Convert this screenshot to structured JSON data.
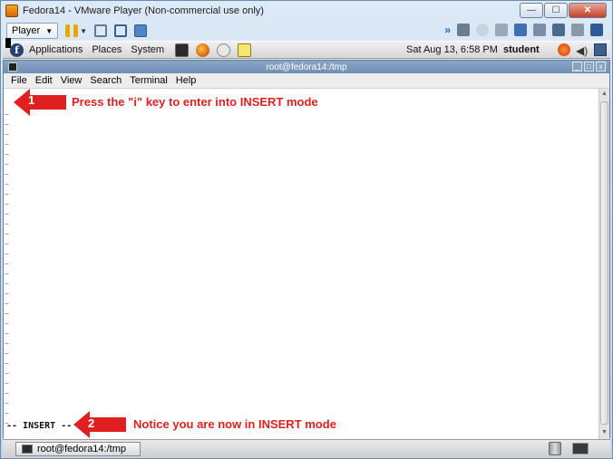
{
  "vm_window": {
    "title": "Fedora14 - VMware Player (Non-commercial use only)",
    "buttons": {
      "minimize": "—",
      "maximize": "☐",
      "close": "✕"
    }
  },
  "vm_toolbar": {
    "player_menu": "Player",
    "player_caret": "▼",
    "pause_caret": "▼",
    "chevron": "»"
  },
  "gnome_panel": {
    "menus": [
      "Applications",
      "Places",
      "System"
    ],
    "fedora_logo": "f",
    "clock": "Sat Aug 13,  6:58 PM",
    "user": "student",
    "volume_glyph": "◀)"
  },
  "terminal": {
    "title": "root@fedora14:/tmp",
    "menu": [
      "File",
      "Edit",
      "View",
      "Search",
      "Terminal",
      "Help"
    ],
    "tilde": "~",
    "tilde_count": 32,
    "mode_line": "-- INSERT --",
    "scroll_up": "▲",
    "scroll_down": "▼"
  },
  "annotations": [
    {
      "number": "1",
      "text": "Press the \"i\" key to enter into INSERT mode"
    },
    {
      "number": "2",
      "text": "Notice you are now in INSERT mode"
    }
  ],
  "bottom_panel": {
    "task_label": "root@fedora14:/tmp"
  },
  "colors": {
    "annotation_red": "#e02020",
    "tilde_blue": "#4a78c0"
  }
}
